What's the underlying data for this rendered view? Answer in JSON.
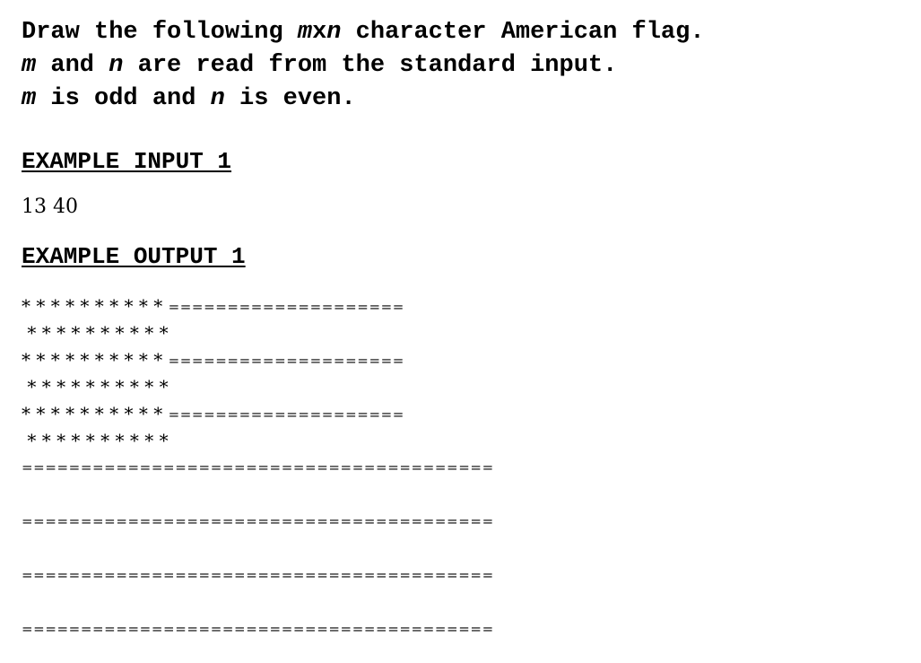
{
  "intro": {
    "line1": [
      {
        "text": "Draw the following ",
        "italic": false
      },
      {
        "text": "m",
        "italic": true
      },
      {
        "text": "x",
        "italic": false
      },
      {
        "text": "n",
        "italic": true
      },
      {
        "text": " character American flag.",
        "italic": false
      }
    ],
    "line2": [
      {
        "text": "m",
        "italic": true
      },
      {
        "text": " and ",
        "italic": false
      },
      {
        "text": "n",
        "italic": true
      },
      {
        "text": " are read from the standard input.",
        "italic": false
      }
    ],
    "line3": [
      {
        "text": "m",
        "italic": true
      },
      {
        "text": " is odd and ",
        "italic": false
      },
      {
        "text": "n",
        "italic": true
      },
      {
        "text": " is even.",
        "italic": false
      }
    ]
  },
  "example_input": {
    "heading": "EXAMPLE INPUT 1",
    "value": "13 40"
  },
  "example_output": {
    "heading": "EXAMPLE OUTPUT 1",
    "lines": [
      {
        "stars": "* * * * * * * * * * ",
        "stripe": "===================="
      },
      {
        "stars": " * * * * * * * * * *",
        "stripe": ""
      },
      {
        "stars": "* * * * * * * * * * ",
        "stripe": "===================="
      },
      {
        "stars": " * * * * * * * * * *",
        "stripe": ""
      },
      {
        "stars": "* * * * * * * * * * ",
        "stripe": "===================="
      },
      {
        "stars": " * * * * * * * * * *",
        "stripe": ""
      },
      {
        "stars": "",
        "stripe": "========================================"
      },
      {
        "stars": "",
        "stripe": ""
      },
      {
        "stars": "",
        "stripe": "========================================"
      },
      {
        "stars": "",
        "stripe": ""
      },
      {
        "stars": "",
        "stripe": "========================================"
      },
      {
        "stars": "",
        "stripe": ""
      },
      {
        "stars": "",
        "stripe": "========================================"
      }
    ]
  }
}
